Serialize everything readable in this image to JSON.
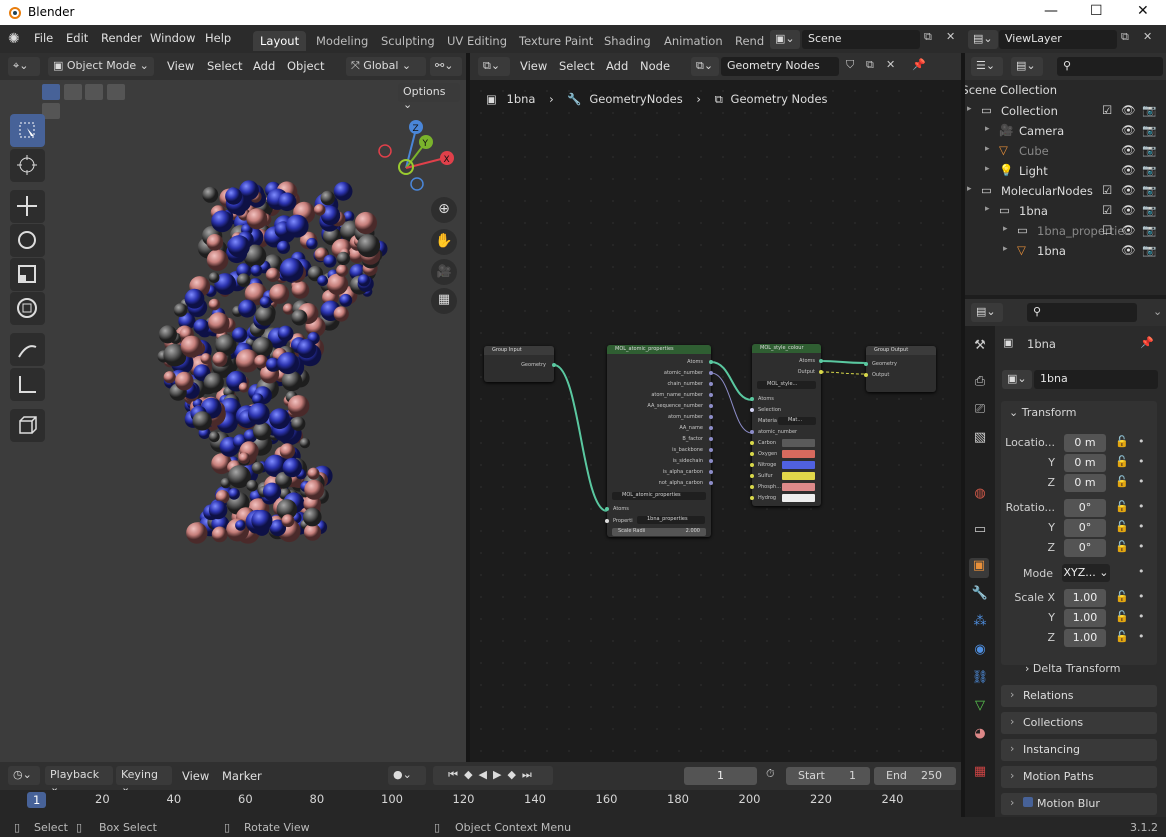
{
  "app": {
    "title": "Blender",
    "version": "3.1.2"
  },
  "menu": [
    "File",
    "Edit",
    "Render",
    "Window",
    "Help"
  ],
  "workspaces": [
    "Layout",
    "Modeling",
    "Sculpting",
    "UV Editing",
    "Texture Paint",
    "Shading",
    "Animation",
    "Rend"
  ],
  "scene": {
    "name": "Scene",
    "view_layer": "ViewLayer"
  },
  "viewport": {
    "mode": "Object Mode",
    "menus": [
      "View",
      "Select",
      "Add",
      "Object"
    ],
    "orientation": "Global",
    "options": "Options",
    "gizmo": {
      "x": "X",
      "y": "Y",
      "z": "Z"
    }
  },
  "node_editor": {
    "menus": [
      "View",
      "Select",
      "Add",
      "Node"
    ],
    "tree_name": "Geometry Nodes",
    "breadcrumb": [
      "1bna",
      "GeometryNodes",
      "Geometry Nodes"
    ],
    "nodes": {
      "group_input": {
        "title": "Group Input",
        "out": "Geometry"
      },
      "atomic": {
        "title": "MOL_atomic_properties",
        "outputs": [
          "Atoms",
          "atomic_number",
          "chain_number",
          "atom_name_number",
          "AA_sequence_number",
          "atom_number",
          "AA_name",
          "B_factor",
          "is_backbone",
          "is_sidechain",
          "is_alpha_carbon",
          "not_alpha_carbon"
        ],
        "group": "MOL_atomic_properties",
        "inputs": [
          "Atoms"
        ],
        "properti_label": "Properti",
        "properti_value": "1bna_properties",
        "scale_label": "Scale Radii",
        "scale_value": "2.000"
      },
      "style": {
        "title": "MOL_style_colour",
        "outputs": [
          "Atoms",
          "Output"
        ],
        "group": "MOL_style...",
        "inputs": [
          "Atoms",
          "Selection"
        ],
        "material_label": "Materia",
        "material_value": "Mat...",
        "atomic_number": "atomic_number",
        "colours": [
          {
            "name": "Carbon",
            "color": "#5a5a5a"
          },
          {
            "name": "Oxygen",
            "color": "#d86a5e"
          },
          {
            "name": "Nitroge",
            "color": "#5061e0"
          },
          {
            "name": "Sulfur",
            "color": "#e2d84a"
          },
          {
            "name": "Phosph...",
            "color": "#dd8a8a"
          },
          {
            "name": "Hydrog",
            "color": "#eeeeee"
          }
        ]
      },
      "group_output": {
        "title": "Group Output",
        "inputs": [
          "Geometry",
          "Output"
        ]
      }
    }
  },
  "outliner": {
    "root": "Scene Collection",
    "rows": [
      {
        "label": "Collection",
        "icon": "collection-icon",
        "indent": 0
      },
      {
        "label": "Camera",
        "icon": "camera-icon",
        "indent": 1
      },
      {
        "label": "Cube",
        "icon": "mesh-icon",
        "indent": 1
      },
      {
        "label": "Light",
        "icon": "light-icon",
        "indent": 1
      },
      {
        "label": "MolecularNodes",
        "icon": "collection-icon",
        "indent": 0
      },
      {
        "label": "1bna",
        "icon": "collection-icon",
        "indent": 1
      },
      {
        "label": "1bna_propertie",
        "icon": "collection-icon",
        "indent": 2
      },
      {
        "label": "1bna",
        "icon": "mesh-icon",
        "indent": 2
      }
    ]
  },
  "properties": {
    "object_name": "1bna",
    "object_field": "1bna",
    "transform": {
      "header": "Transform",
      "location_label": "Locatio...",
      "location": [
        "0 m",
        "0 m",
        "0 m"
      ],
      "rotation_label": "Rotatio...",
      "rotation": [
        "0°",
        "0°",
        "0°"
      ],
      "mode_label": "Mode",
      "mode": "XYZ...",
      "scale_label": "Scale X",
      "scale": [
        "1.00",
        "1.00",
        "1.00"
      ],
      "axes": [
        "X",
        "Y",
        "Z"
      ]
    },
    "delta": "Delta Transform",
    "panels": [
      "Relations",
      "Collections",
      "Instancing",
      "Motion Paths",
      "Motion Blur"
    ]
  },
  "timeline": {
    "menus": [
      "Playback",
      "Keying",
      "View",
      "Marker"
    ],
    "current_frame": "1",
    "start_label": "Start",
    "start": "1",
    "end_label": "End",
    "end": "250",
    "ticks": [
      "1",
      "20",
      "40",
      "60",
      "80",
      "100",
      "120",
      "140",
      "160",
      "180",
      "200",
      "220",
      "240"
    ]
  },
  "statusbar": {
    "select": "Select",
    "box_select": "Box Select",
    "rotate": "Rotate View",
    "context": "Object Context Menu"
  }
}
